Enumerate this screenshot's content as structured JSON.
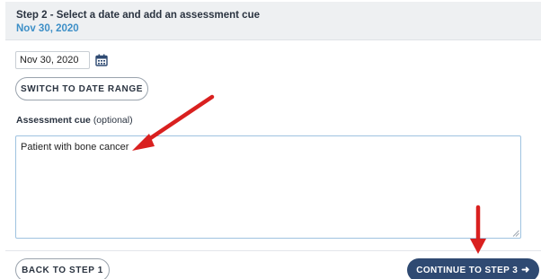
{
  "header": {
    "step_title": "Step 2 - Select a date and add an assessment cue",
    "selected_date": "Nov 30, 2020"
  },
  "date_picker": {
    "value": "Nov 30, 2020",
    "icon": "calendar-icon"
  },
  "buttons": {
    "switch_label": "SWITCH TO DATE RANGE",
    "back_label": "BACK TO STEP 1",
    "continue_label": "CONTINUE TO STEP 3",
    "continue_arrow": "➜"
  },
  "cue": {
    "label_bold": "Assessment cue",
    "label_optional": "(optional)",
    "value": "Patient with bone cancer"
  },
  "colors": {
    "accent_blue": "#3d8fc7",
    "primary_button": "#2f4a72",
    "annotation_arrow": "#d9201f",
    "header_background": "#eef0f2"
  }
}
